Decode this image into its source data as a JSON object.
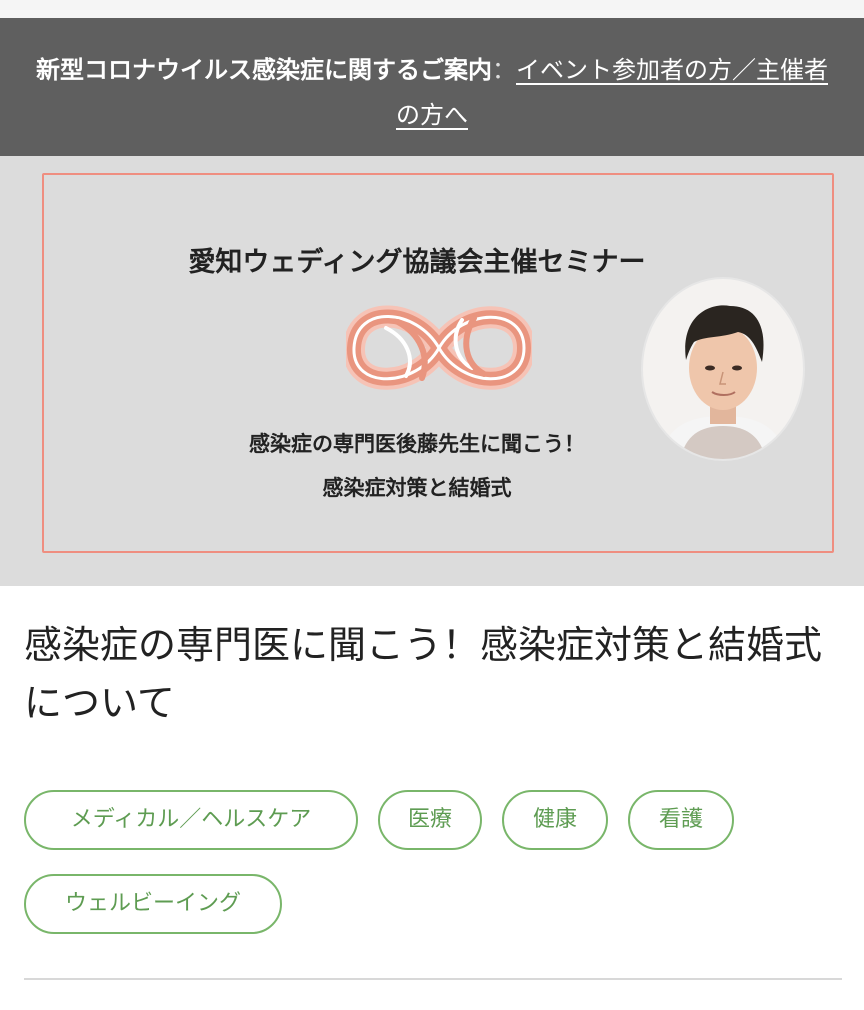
{
  "notice": {
    "label": "新型コロナウイルス感染症に関するご案内",
    "separator": "：",
    "link_line1": "イベント参加者の方／主催者",
    "link_line2": "の方へ"
  },
  "banner": {
    "title": "愛知ウェディング協議会主催セミナー",
    "subtitle_line1": "感染症の専門医後藤先生に聞こう！",
    "subtitle_line2": "感染症対策と結婚式",
    "frame_color": "#ef8e80"
  },
  "event": {
    "title": "感染症の専門医に聞こう！感染症対策と結婚式について"
  },
  "tags": [
    "メディカル／ヘルスケア",
    "医療",
    "健康",
    "看護",
    "ウェルビーイング"
  ],
  "colors": {
    "notice_bg": "#5f5f5f",
    "banner_bg": "#dcdcdc",
    "tag_green": "#79b66a"
  }
}
